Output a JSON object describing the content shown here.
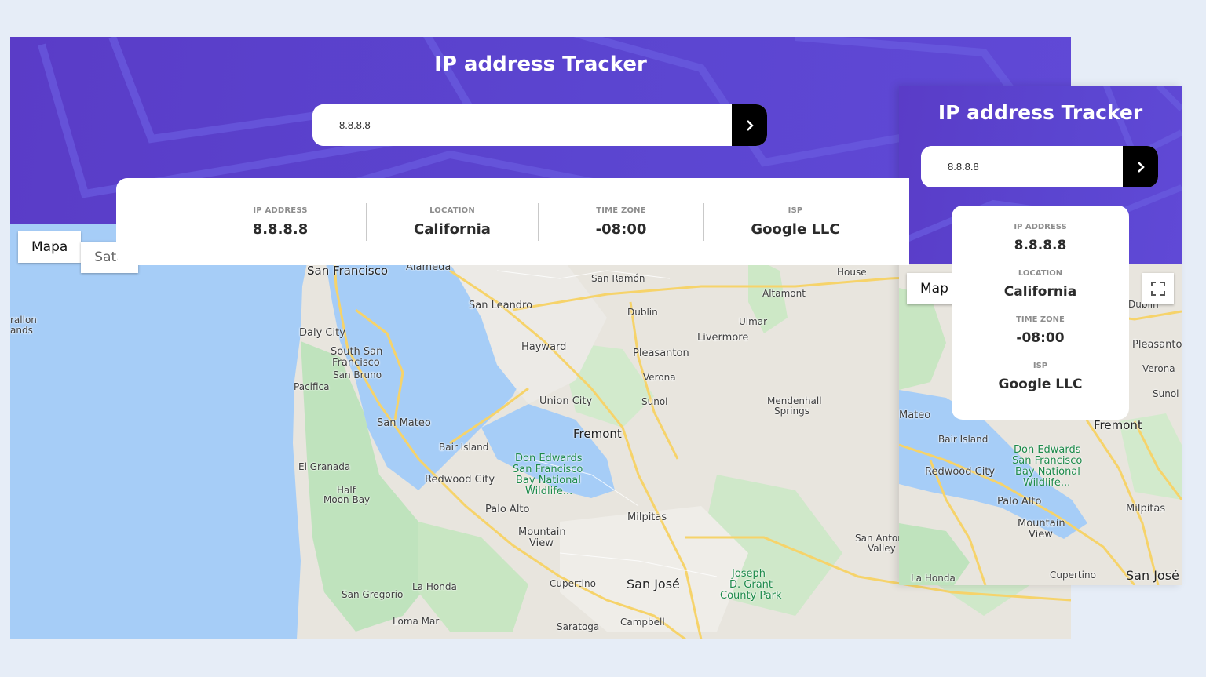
{
  "app": {
    "title": "IP address Tracker"
  },
  "search": {
    "value_desktop": "8.8.8.8",
    "value_mobile": "8.8.8.8",
    "placeholder": ""
  },
  "stats": [
    {
      "label": "IP ADDRESS",
      "value": "8.8.8.8"
    },
    {
      "label": "LOCATION",
      "value": "California"
    },
    {
      "label": "TIME ZONE",
      "value": "-08:00"
    },
    {
      "label": "ISP",
      "value": "Google LLC"
    }
  ],
  "map_controls": {
    "map": "Mapa",
    "satellite": "Saté",
    "map_mobile": "Map"
  },
  "colors": {
    "header": "#5b45d0",
    "button": "#000000",
    "water": "#a6cdf7",
    "park": "#bfe3bd",
    "road": "#f6d36a"
  },
  "map_labels_desktop": {
    "sf": "San Francisco",
    "alameda": "Alameda",
    "sanramon": "San Ramón",
    "altamont": "Altamont",
    "house": "House",
    "sanleandro": "San Leandro",
    "dublin": "Dublin",
    "ulmar": "Ulmar",
    "farallon1": "rallon",
    "farallon2": "ands",
    "dalycity": "Daly City",
    "hayward": "Hayward",
    "livermore": "Livermore",
    "pleasanton": "Pleasanton",
    "ssf1": "South San",
    "ssf2": "Francisco",
    "sanbruno": "San Bruno",
    "pacifica": "Pacifica",
    "verona": "Verona",
    "unioncity": "Union City",
    "sunol": "Sunol",
    "mendenhall1": "Mendenhall",
    "mendenhall2": "Springs",
    "sanmateo": "San Mateo",
    "fremont": "Fremont",
    "bairisland": "Bair Island",
    "elgranada": "El Granada",
    "donedwards1": "Don Edwards",
    "donedwards2": "San Francisco",
    "donedwards3": "Bay National",
    "donedwards4": "Wildlife...",
    "redwoodcity": "Redwood City",
    "half1": "Half",
    "half2": "Moon Bay",
    "paloalto": "Palo Alto",
    "milpitas": "Milpitas",
    "mtnview1": "Mountain",
    "mtnview2": "View",
    "sanantonio1": "San Antoni",
    "sanantonio2": "Valley",
    "lahonda": "La Honda",
    "cupertino": "Cupertino",
    "sanjose": "San José",
    "joseph1": "Joseph",
    "joseph2": "D. Grant",
    "joseph3": "County Park",
    "sangregorio": "San Gregorio",
    "lomamar": "Loma Mar",
    "saratoga": "Saratoga",
    "campbell": "Campbell"
  },
  "map_labels_mobile": {
    "dublin": "Dublin",
    "pleasanton": "Pleasanton",
    "verona": "Verona",
    "sunol": "Sunol",
    "mateo": "Mateo",
    "fremont": "Fremont",
    "bairisland": "Bair Island",
    "redwoodcity": "Redwood City",
    "donedwards1": "Don Edwards",
    "donedwards2": "San Francisco",
    "donedwards3": "Bay National",
    "donedwards4": "Wildlife...",
    "paloalto": "Palo Alto",
    "milpitas": "Milpitas",
    "mtnview1": "Mountain",
    "mtnview2": "View",
    "lahonda": "La Honda",
    "cupertino": "Cupertino",
    "sanjose": "San José"
  }
}
